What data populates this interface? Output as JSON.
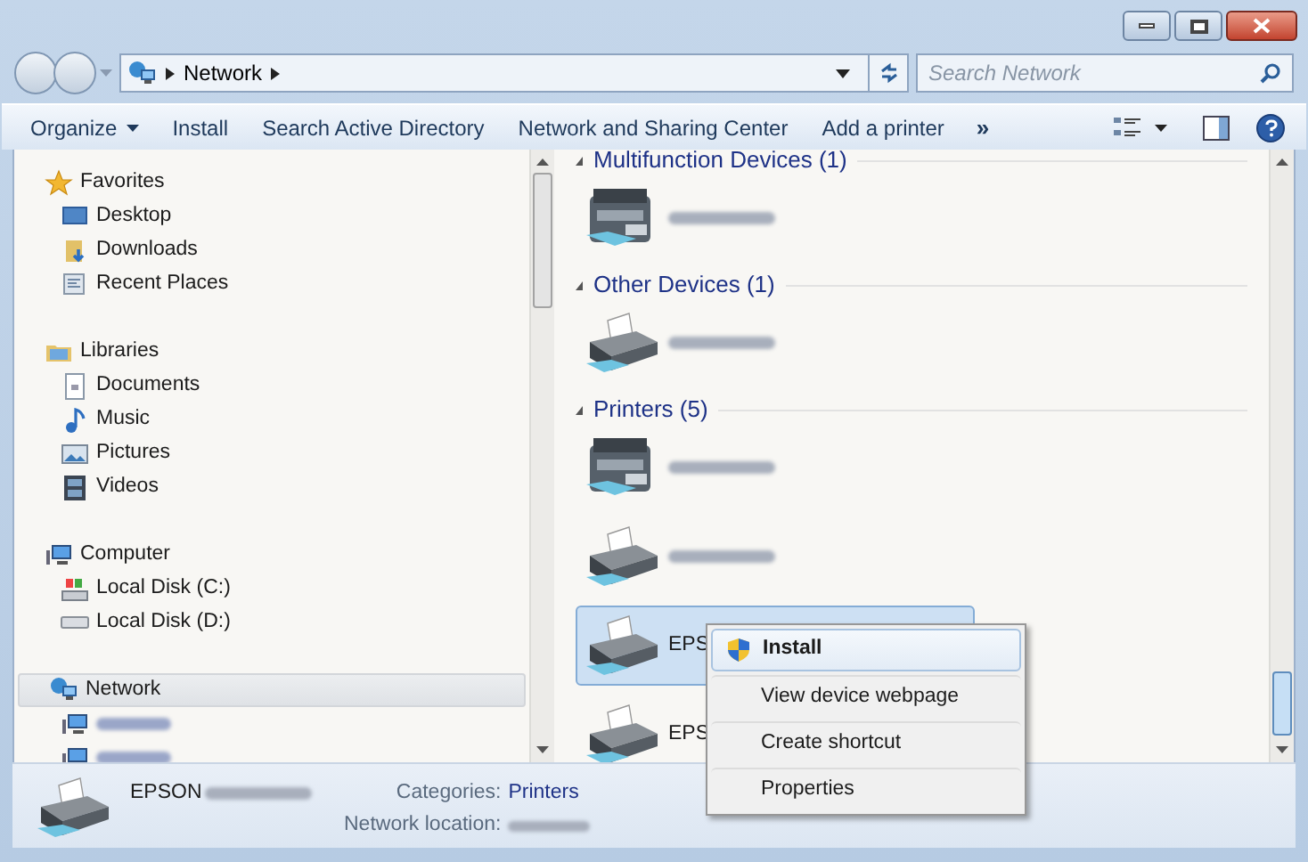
{
  "address_bar": {
    "crumbs": [
      "Network"
    ]
  },
  "search": {
    "placeholder": "Search Network"
  },
  "toolbar": {
    "items": [
      {
        "label": "Organize",
        "dropdown": true
      },
      {
        "label": "Install",
        "dropdown": false
      },
      {
        "label": "Search Active Directory",
        "dropdown": false
      },
      {
        "label": "Network and Sharing Center",
        "dropdown": false
      },
      {
        "label": "Add a printer",
        "dropdown": false
      }
    ],
    "overflow": "»"
  },
  "sidebar": {
    "groups": [
      {
        "label": "Favorites",
        "kind": "star",
        "selected": false,
        "children": [
          {
            "label": "Desktop",
            "kind": "desktop",
            "selected": false
          },
          {
            "label": "Downloads",
            "kind": "downloads",
            "selected": false
          },
          {
            "label": "Recent Places",
            "kind": "recent",
            "selected": false
          }
        ]
      },
      {
        "label": "Libraries",
        "kind": "library",
        "selected": false,
        "children": [
          {
            "label": "Documents",
            "kind": "document",
            "selected": false
          },
          {
            "label": "Music",
            "kind": "music",
            "selected": false
          },
          {
            "label": "Pictures",
            "kind": "picture",
            "selected": false
          },
          {
            "label": "Videos",
            "kind": "video",
            "selected": false
          }
        ]
      },
      {
        "label": "Computer",
        "kind": "computer",
        "selected": false,
        "children": [
          {
            "label": "Local Disk (C:)",
            "kind": "systemdisk",
            "selected": false
          },
          {
            "label": "Local Disk (D:)",
            "kind": "disk",
            "selected": false
          }
        ]
      },
      {
        "label": "Network",
        "kind": "network",
        "selected": true,
        "children": [
          {
            "kind": "computer-blurred",
            "selected": false
          },
          {
            "kind": "computer-blurred",
            "selected": false
          }
        ]
      }
    ]
  },
  "content": {
    "groups": [
      {
        "title": "Multifunction Devices (1)",
        "items": [
          {
            "kind": "multifunction",
            "selected": false
          }
        ]
      },
      {
        "title": "Other Devices (1)",
        "items": [
          {
            "kind": "printer",
            "selected": false
          }
        ]
      },
      {
        "title": "Printers (5)",
        "items": [
          {
            "kind": "multifunction",
            "selected": false
          },
          {
            "kind": "printer",
            "selected": false
          },
          {
            "kind": "printer",
            "label": "EPS",
            "selected": true
          },
          {
            "kind": "printer",
            "label": "EPS",
            "selected": false
          }
        ]
      }
    ]
  },
  "context_menu": {
    "items": [
      {
        "label": "Install",
        "kind": "default",
        "shield": true,
        "selected": true
      },
      {
        "label": "View device webpage",
        "kind": "normal",
        "shield": false,
        "selected": false
      },
      {
        "label": "Create shortcut",
        "kind": "normal",
        "shield": false,
        "selected": false
      },
      {
        "label": "Properties",
        "kind": "normal",
        "shield": false,
        "selected": false
      }
    ]
  },
  "details": {
    "name": "EPSON",
    "fields": [
      {
        "label": "Categories:",
        "value": "Printers"
      },
      {
        "label": "Network location:"
      }
    ]
  }
}
